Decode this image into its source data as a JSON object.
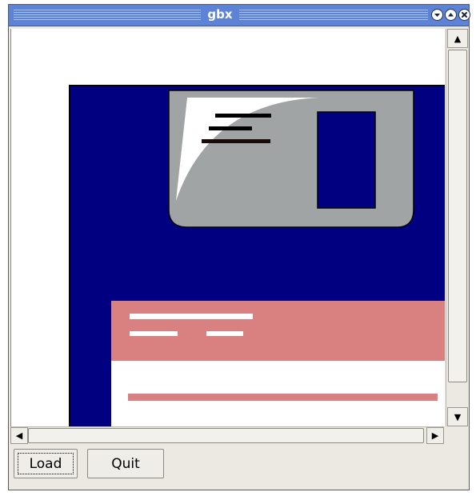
{
  "window": {
    "title": "gbx",
    "title_buttons": [
      "minimize-icon",
      "maximize-icon",
      "close-icon"
    ]
  },
  "canvas": {
    "description_icon": "floppy-disk-icon",
    "colors": {
      "disk_body": "#000080",
      "shutter": "#a0a4a5",
      "label_band": "#d98080",
      "label_body": "#ffffff"
    }
  },
  "buttons": {
    "load": "Load",
    "quit": "Quit"
  },
  "colors": {
    "titlebar": "#5c83d6",
    "window_bg": "#ece9e2"
  }
}
